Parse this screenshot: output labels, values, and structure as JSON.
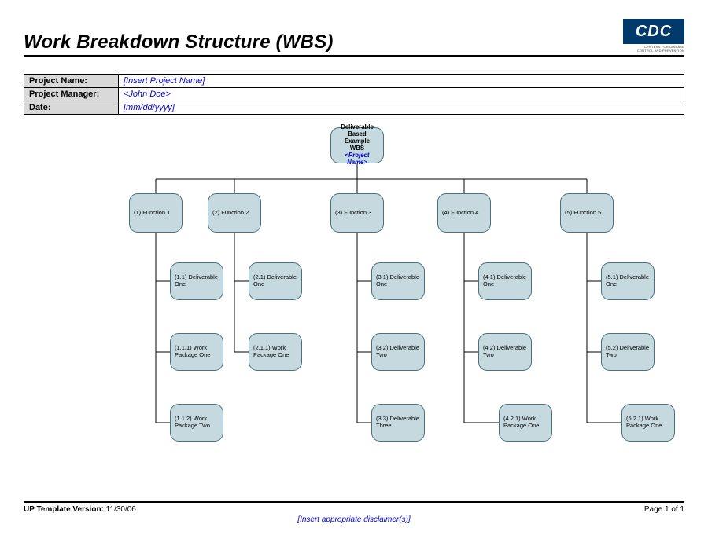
{
  "header": {
    "title": "Work Breakdown Structure (WBS)",
    "logo_text": "CDC",
    "logo_sub1": "CENTERS FOR DISEASE",
    "logo_sub2": "CONTROL AND PREVENTION"
  },
  "meta": {
    "project_name_label": "Project Name:",
    "project_name_value": "[Insert Project Name]",
    "project_manager_label": "Project Manager:",
    "project_manager_value": "<John Doe>",
    "date_label": "Date:",
    "date_value": "[mm/dd/yyyy]"
  },
  "nodes": {
    "root_l1": "Deliverable",
    "root_l2": "Based Example",
    "root_l3": "WBS",
    "root_l4": "<Project Name>",
    "f1": "(1) Function 1",
    "f2": "(2) Function 2",
    "f3": "(3) Function 3",
    "f4": "(4) Function 4",
    "f5": "(5) Function 5",
    "d11": "(1.1) Deliverable One",
    "d21": "(2.1) Deliverable One",
    "d31": "(3.1) Deliverable One",
    "d41": "(4.1) Deliverable One",
    "d51": "(5.1) Deliverable One",
    "w111": "(1.1.1) Work Package One",
    "w211": "(2.1.1) Work Package One",
    "d32": "(3.2) Deliverable Two",
    "d42": "(4.2) Deliverable Two",
    "d52": "(5.2) Deliverable Two",
    "w112": "(1.1.2) Work Package Two",
    "d33": "(3.3) Deliverable Three",
    "w421": "(4.2.1) Work Package One",
    "w521": "(5.2.1) Work Package One"
  },
  "footer": {
    "version_label": "UP Template Version:",
    "version_value": "11/30/06",
    "page": "Page 1 of 1",
    "disclaimer": "[Insert appropriate disclaimer(s)]"
  }
}
